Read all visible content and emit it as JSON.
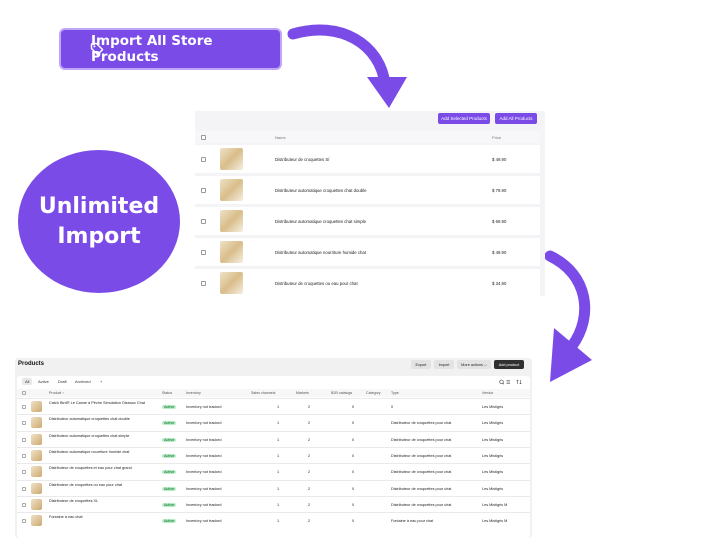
{
  "import_button": {
    "label": "Import All Store Products",
    "icon": "tag-icon"
  },
  "badge_circle": {
    "line1": "Unlimited",
    "line2": "Import"
  },
  "top_panel": {
    "add_selected_label": "Add Selected Products",
    "add_all_label": "Add All Products",
    "columns": {
      "name": "Name",
      "price": "Price"
    },
    "rows": [
      {
        "name": "Distributeur de croquettes Sí",
        "price": "$ 49.90"
      },
      {
        "name": "Distributeur automatique croquettes chat double",
        "price": "$ 79.90"
      },
      {
        "name": "Distributeur automatique croquettes chat simple",
        "price": "$ 69.90"
      },
      {
        "name": "Distributeur automatique nourriture humide chat",
        "price": "$ 49.90"
      },
      {
        "name": "Distributeur de croquettes ou eau pour chat",
        "price": "$ 34.90"
      }
    ]
  },
  "bottom_panel": {
    "title": "Products",
    "toolbar": {
      "export": "Export",
      "import": "Import",
      "more_actions": "More actions ⌵",
      "add_product": "Add product"
    },
    "filters": [
      "All",
      "Active",
      "Draft",
      "Archived",
      "+"
    ],
    "columns": [
      "Product ↑",
      "Status",
      "Inventory",
      "Sales channels",
      "Markets",
      "B2B catalogs",
      "Category",
      "Type",
      "Vendor"
    ],
    "rows": [
      {
        "product": "Catch Bird® Le Canne à Pêche Simulation Oiseaux Chat",
        "status": "Active",
        "inventory": "Inventory not tracked",
        "channels": "1",
        "markets": "2",
        "b2b": "0",
        "type": "0",
        "vendor": "Les Mistigris"
      },
      {
        "product": "Distributeur automatique croquettes chat double",
        "status": "Active",
        "inventory": "Inventory not tracked",
        "channels": "1",
        "markets": "2",
        "b2b": "0",
        "type": "Distributeur de croquettes pour chat",
        "vendor": "Les Mistigris"
      },
      {
        "product": "Distributeur automatique croquettes chat simple",
        "status": "Active",
        "inventory": "Inventory not tracked",
        "channels": "1",
        "markets": "2",
        "b2b": "0",
        "type": "Distributeur de croquettes pour chat",
        "vendor": "Les Mistigris"
      },
      {
        "product": "Distributeur automatique nourriture humide chat",
        "status": "Active",
        "inventory": "Inventory not tracked",
        "channels": "1",
        "markets": "2",
        "b2b": "0",
        "type": "Distributeur de croquettes pour chat",
        "vendor": "Les Mistigris"
      },
      {
        "product": "Distributeur de croquettes et eau pour chat grand",
        "status": "Active",
        "inventory": "Inventory not tracked",
        "channels": "1",
        "markets": "2",
        "b2b": "0",
        "type": "Distributeur de croquettes pour chat",
        "vendor": "Les Mistigris"
      },
      {
        "product": "Distributeur de croquettes ou eau pour chat",
        "status": "Active",
        "inventory": "Inventory not tracked",
        "channels": "1",
        "markets": "2",
        "b2b": "0",
        "type": "Distributeur de croquettes pour chat",
        "vendor": "Les Mistigris"
      },
      {
        "product": "Distributeur de croquettes XL",
        "status": "Active",
        "inventory": "Inventory not tracked",
        "channels": "1",
        "markets": "2",
        "b2b": "0",
        "type": "Distributeur de croquettes pour chat",
        "vendor": "Les Mistigris M"
      },
      {
        "product": "Fontaine à eau chat",
        "status": "Active",
        "inventory": "Inventory not tracked",
        "channels": "1",
        "markets": "2",
        "b2b": "0",
        "type": "Fontaine à eau pour chat",
        "vendor": "Les Mistigris M"
      }
    ]
  },
  "colors": {
    "accent": "#7b4be8",
    "accent_border": "#bfa6f7",
    "active_badge": "#b7efc5"
  }
}
